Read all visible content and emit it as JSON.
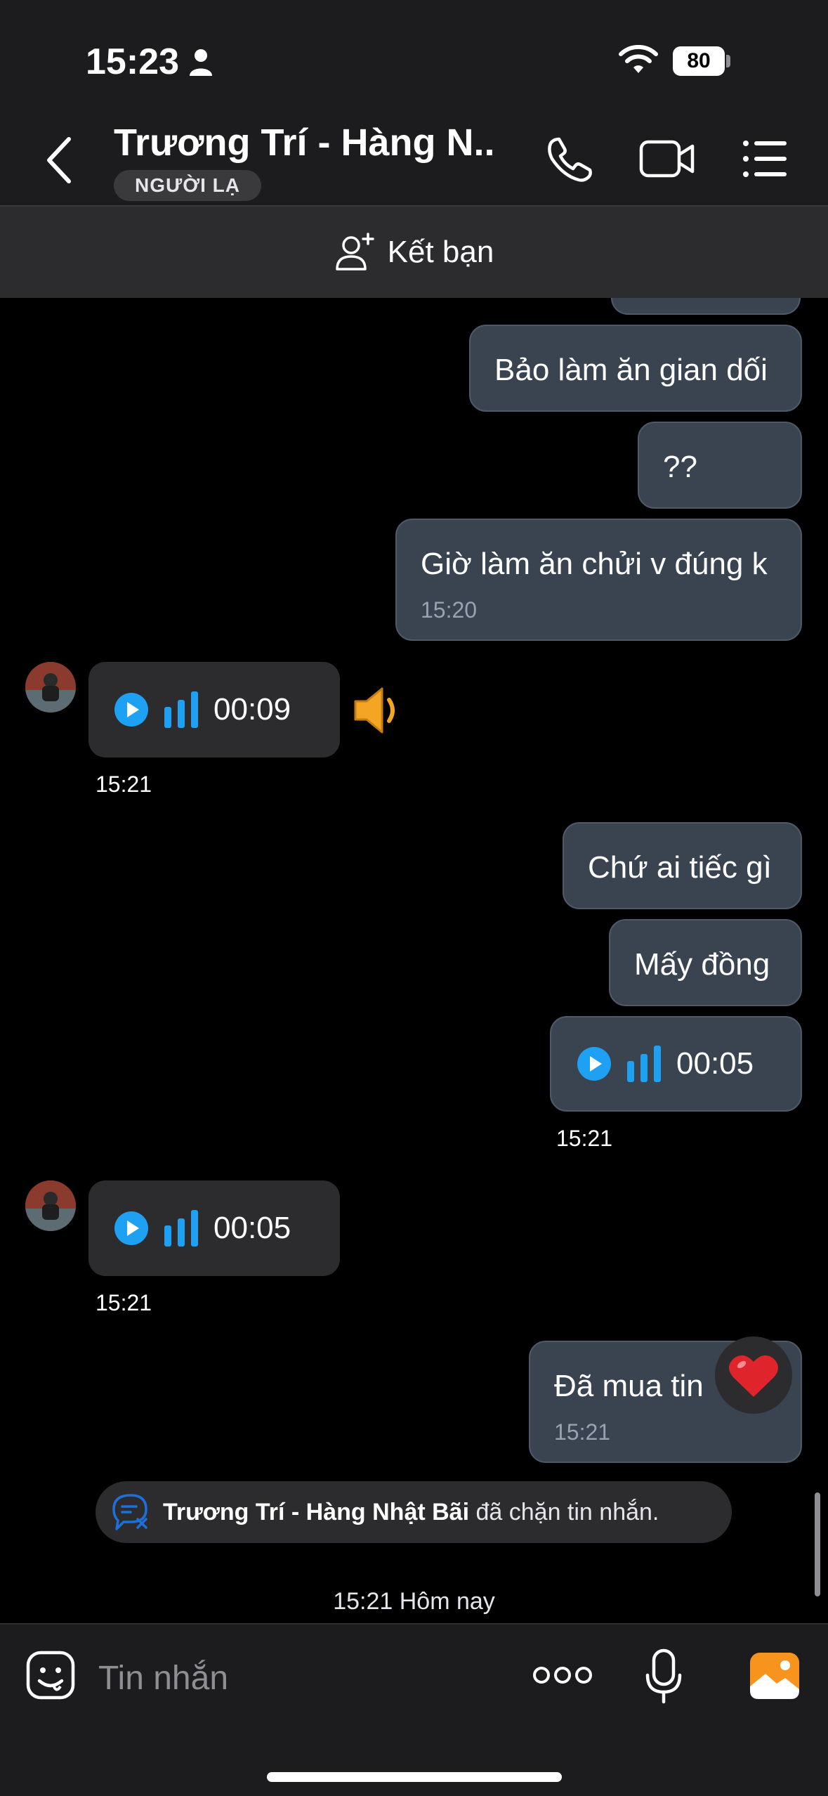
{
  "status_bar": {
    "time": "15:23",
    "battery": "80"
  },
  "header": {
    "title": "Trương Trí - Hàng N...",
    "badge": "NGƯỜI LẠ"
  },
  "add_friend": {
    "label": "Kết bạn"
  },
  "messages": {
    "m1": {
      "text": "Bảo làm ăn gian dối"
    },
    "m2": {
      "text": "??"
    },
    "m3": {
      "text": "Giờ làm ăn chửi v đúng k",
      "time": "15:20"
    },
    "v1": {
      "duration": "00:09",
      "time": "15:21"
    },
    "m4": {
      "text": "Chứ ai tiếc gì"
    },
    "m5": {
      "text": "Mấy đồng"
    },
    "v2": {
      "duration": "00:05",
      "time": "15:21"
    },
    "v3": {
      "duration": "00:05",
      "time": "15:21"
    },
    "m6": {
      "text": "Đã mua tin",
      "time": "15:21",
      "reaction": "❤️"
    }
  },
  "system_notice": {
    "name": "Trương Trí - Hàng Nhật Bãi",
    "text": " đã chặn tin nhắn."
  },
  "date_divider": "15:21 Hôm nay",
  "composer": {
    "placeholder": "Tin nhắn"
  },
  "colors": {
    "accent": "#1ea1f2",
    "bubble_out": "#3a4350",
    "bubble_in": "#2c2c2e",
    "image_button": "#f7941d"
  }
}
